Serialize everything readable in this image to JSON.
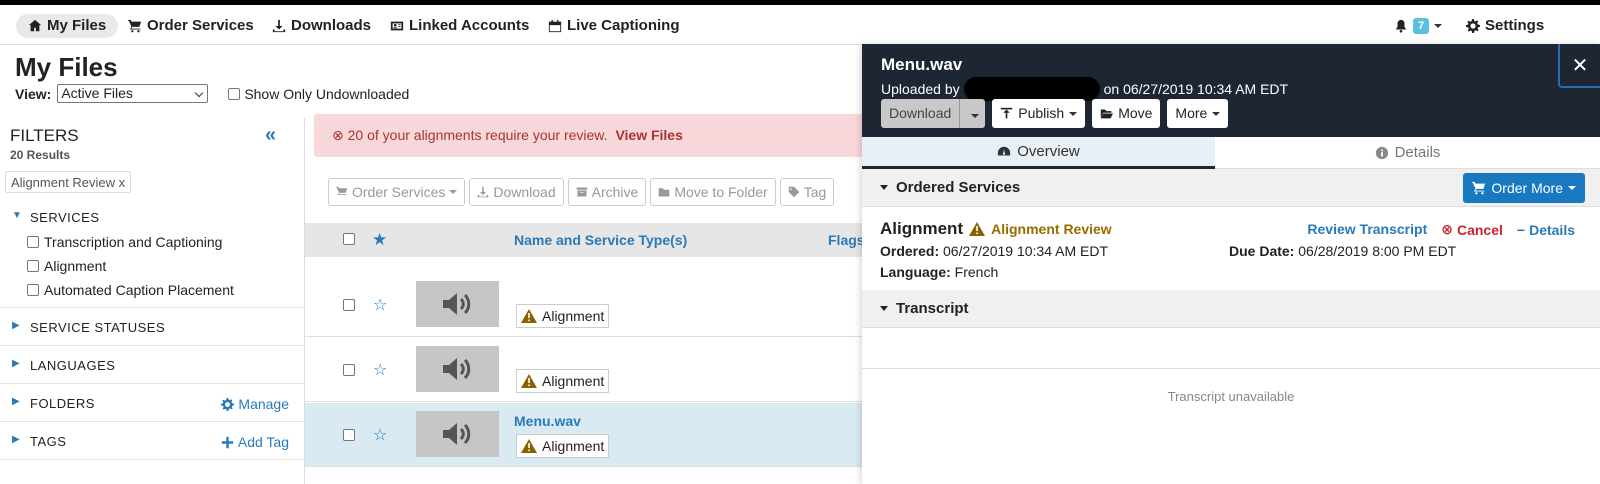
{
  "nav": {
    "my_files": "My Files",
    "order_services": "Order Services",
    "downloads": "Downloads",
    "linked_accounts": "Linked Accounts",
    "live_captioning": "Live Captioning",
    "notif_count": "7",
    "settings": "Settings"
  },
  "page": {
    "title": "My Files",
    "view_label": "View:",
    "view_value": "Active Files",
    "show_undownloaded": "Show Only Undownloaded"
  },
  "filters": {
    "title": "FILTERS",
    "results": "20 Results",
    "active_chip": "Alignment Review x",
    "services_label": "SERVICES",
    "services": [
      "Transcription and Captioning",
      "Alignment",
      "Automated Caption Placement"
    ],
    "service_statuses": "SERVICE STATUSES",
    "languages": "LANGUAGES",
    "folders": "FOLDERS",
    "manage": "Manage",
    "tags": "TAGS",
    "add_tag": "Add Tag"
  },
  "alert": {
    "text": "20 of your alignments require your review.",
    "link": "View Files"
  },
  "toolbar": {
    "order_services": "Order Services",
    "download": "Download",
    "archive": "Archive",
    "move_to_folder": "Move to Folder",
    "tag": "Tag"
  },
  "table": {
    "col_name": "Name and Service Type(s)",
    "col_flags": "Flags",
    "rows": [
      {
        "name": "",
        "tag": "Alignment"
      },
      {
        "name": "",
        "tag": "Alignment"
      },
      {
        "name": "Menu.wav",
        "tag": "Alignment"
      }
    ]
  },
  "panel": {
    "filename": "Menu.wav",
    "uploaded_by": "Uploaded by",
    "uploaded_on": "on 06/27/2019 10:34 AM EDT",
    "download": "Download",
    "publish": "Publish",
    "move": "Move",
    "more": "More",
    "tab_overview": "Overview",
    "tab_details": "Details",
    "ordered_services": "Ordered Services",
    "order_more": "Order More",
    "service_name": "Alignment",
    "service_status": "Alignment Review",
    "review_transcript": "Review Transcript",
    "cancel": "Cancel",
    "details": "Details",
    "ordered_label": "Ordered:",
    "ordered_value": "06/27/2019 10:34 AM EDT",
    "due_label": "Due Date:",
    "due_value": "06/28/2019 8:00 PM EDT",
    "language_label": "Language:",
    "language_value": "French",
    "transcript": "Transcript",
    "transcript_unavailable": "Transcript unavailable"
  },
  "colors": {
    "accent": "#2a7ab8",
    "panel_header": "#1f2633",
    "alert_bg": "#f8d7da",
    "warning": "#9a6b00",
    "danger": "#c82333",
    "selected_row": "#d9eaf2"
  }
}
